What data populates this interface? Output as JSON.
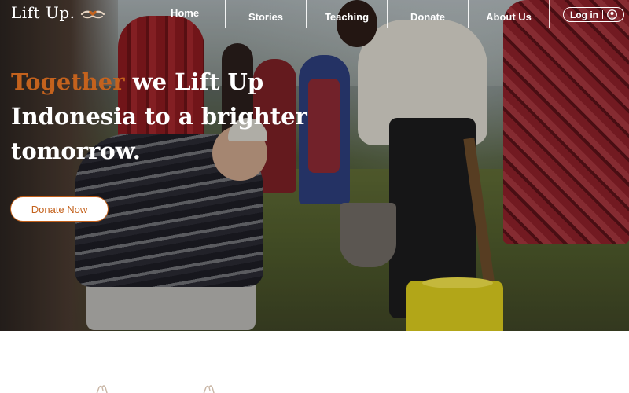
{
  "brand": {
    "name": "Lift Up.",
    "logo_icon": "hands-heart-icon"
  },
  "nav": {
    "items": [
      {
        "label": "Home"
      },
      {
        "label": "Stories"
      },
      {
        "label": "Teaching"
      },
      {
        "label": "Donate"
      },
      {
        "label": "About Us"
      }
    ],
    "login_label": "Log in",
    "login_icon": "user-icon"
  },
  "hero": {
    "headline_accent": "Together",
    "headline_rest": " we Lift Up Indonesia to a brighter tomorrow.",
    "cta_label": "Donate Now"
  },
  "colors": {
    "accent": "#c4621d",
    "text_on_hero": "#ffffff",
    "background": "#ffffff"
  },
  "section_icons": [
    "hand-icon",
    "hand-icon"
  ]
}
